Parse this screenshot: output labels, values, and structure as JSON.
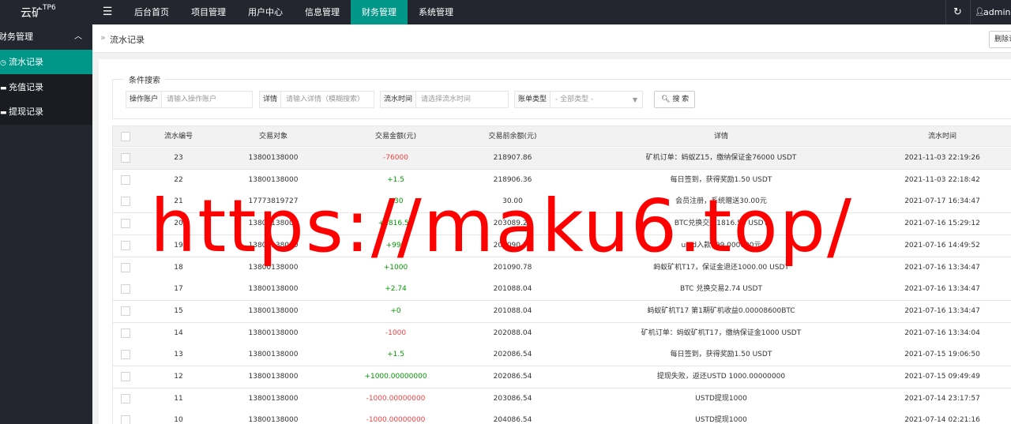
{
  "app": {
    "logo": "云矿",
    "logo_sup": "TP6"
  },
  "header": {
    "menu_icon": "menu-icon",
    "nav": [
      "后台首页",
      "项目管理",
      "用户中心",
      "信息管理",
      "财务管理",
      "系统管理"
    ],
    "active_nav": "财务管理",
    "refresh_icon": "refresh-icon",
    "user": "admin",
    "accent_color": "#009688"
  },
  "sidebar": {
    "group": "财务管理",
    "items": [
      {
        "label": "流水记录",
        "icon": "clock-icon",
        "active": true
      },
      {
        "label": "充值记录",
        "icon": "card-icon",
        "active": false
      },
      {
        "label": "提现记录",
        "icon": "card-icon",
        "active": false
      }
    ]
  },
  "breadcrumb": {
    "sep": "»",
    "current": "流水记录",
    "delete_label": "删除记录"
  },
  "search": {
    "legend": "条件搜索",
    "fields": [
      {
        "label": "操作账户",
        "placeholder": "请输入操作账户"
      },
      {
        "label": "详情",
        "placeholder": "请输入详情（模糊搜索）"
      },
      {
        "label": "流水时间",
        "placeholder": "请选择流水时间"
      },
      {
        "label": "账单类型",
        "placeholder": "- 全部类型 -"
      }
    ],
    "button": "搜 索"
  },
  "table": {
    "headers": [
      "流水编号",
      "交易对象",
      "交易金额(元)",
      "交易前余额(元)",
      "详情",
      "流水时间"
    ],
    "rows": [
      {
        "id": "23",
        "obj": "13800138000",
        "amt": "-76000",
        "bal": "218907.86",
        "det": "矿机订单：蚂蚁Z15，缴纳保证金76000 USDT",
        "time": "2021-11-03 22:19:26"
      },
      {
        "id": "22",
        "obj": "13800138000",
        "amt": "+1.5",
        "bal": "218906.36",
        "det": "每日签到，获得奖励1.50 USDT",
        "time": "2021-11-03 22:18:42"
      },
      {
        "id": "21",
        "obj": "17773819727",
        "amt": "+30",
        "bal": "30.00",
        "det": "会员注册，系统赠送30.00元",
        "time": "2021-07-17 16:34:47"
      },
      {
        "id": "20",
        "obj": "13800138000",
        "amt": "+1816.58",
        "bal": "203089.20",
        "det": "BTC兑换交易1816.58 USDT",
        "time": "2021-07-16 15:29:12"
      },
      {
        "id": "19",
        "obj": "13800138000",
        "amt": "+999",
        "bal": "202090.78",
        "det": "ustd入款999.000000元",
        "time": "2021-07-16 14:49:52"
      },
      {
        "id": "18",
        "obj": "13800138000",
        "amt": "+1000",
        "bal": "201090.78",
        "det": "蚂蚁矿机T17，保证金退还1000.00 USDT",
        "time": "2021-07-16 13:34:47"
      },
      {
        "id": "17",
        "obj": "13800138000",
        "amt": "+2.74",
        "bal": "201088.04",
        "det": "BTC 兑换交易2.74 USDT",
        "time": "2021-07-16 13:34:47"
      },
      {
        "id": "15",
        "obj": "13800138000",
        "amt": "+0",
        "bal": "201088.04",
        "det": "蚂蚁矿机T17 第1期矿机收益0.00008600BTC",
        "time": "2021-07-16 13:34:47"
      },
      {
        "id": "14",
        "obj": "13800138000",
        "amt": "-1000",
        "bal": "202088.04",
        "det": "矿机订单：蚂蚁矿机T17，缴纳保证金1000 USDT",
        "time": "2021-07-16 13:34:04"
      },
      {
        "id": "13",
        "obj": "13800138000",
        "amt": "+1.5",
        "bal": "202086.54",
        "det": "每日签到，获得奖励1.50 USDT",
        "time": "2021-07-15 19:06:50"
      },
      {
        "id": "12",
        "obj": "13800138000",
        "amt": "+1000.00000000",
        "bal": "202086.54",
        "det": "提现失败，返还USTD 1000.00000000",
        "time": "2021-07-15 09:49:49"
      },
      {
        "id": "11",
        "obj": "13800138000",
        "amt": "-1000.00000000",
        "bal": "203086.54",
        "det": "USTD提现1000",
        "time": "2021-07-14 23:17:57"
      },
      {
        "id": "10",
        "obj": "13800138000",
        "amt": "-1000.00000000",
        "bal": "204086.54",
        "det": "USTD提现1000",
        "time": "2021-07-14 02:21:16"
      }
    ]
  },
  "watermark": "https://maku6.top/"
}
